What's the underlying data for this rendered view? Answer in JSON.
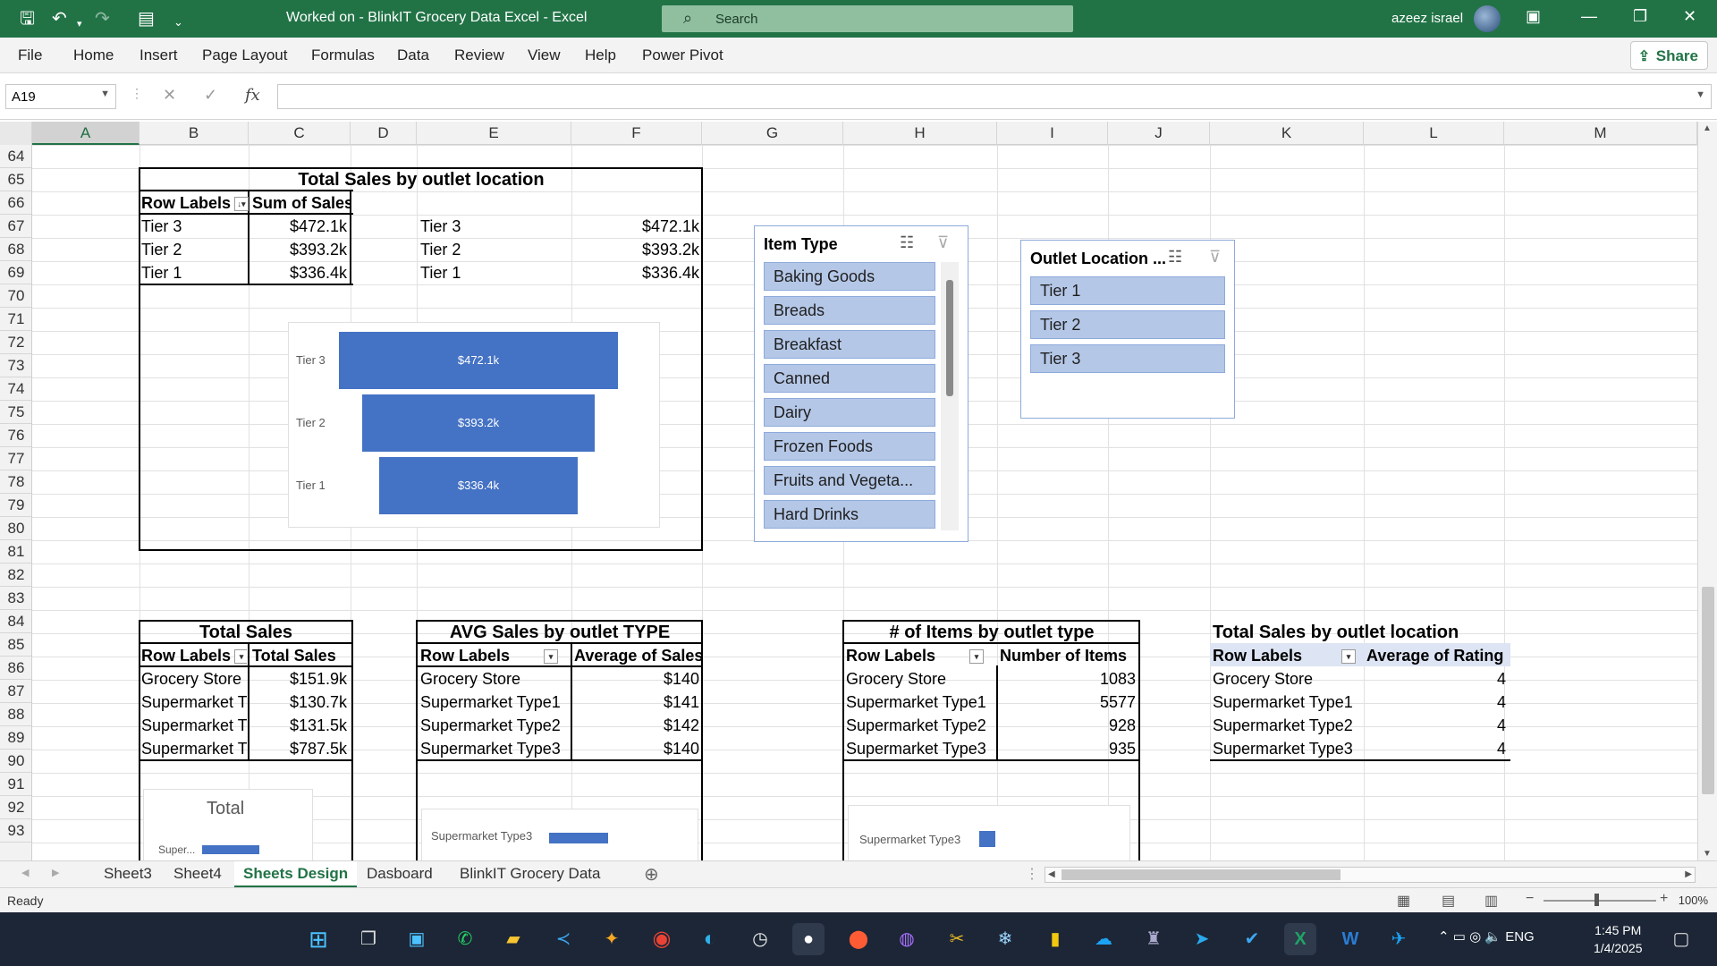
{
  "window": {
    "title": "Worked on - BlinkIT Grocery Data Excel  -  Excel",
    "search_placeholder": "Search",
    "user_name": "azeez israel"
  },
  "ribbon": {
    "tabs": [
      "File",
      "Home",
      "Insert",
      "Page Layout",
      "Formulas",
      "Data",
      "Review",
      "View",
      "Help",
      "Power Pivot"
    ],
    "share_label": "Share"
  },
  "formula_bar": {
    "name_box": "A19",
    "fx": "fx",
    "formula": ""
  },
  "columns": [
    "A",
    "B",
    "C",
    "D",
    "E",
    "F",
    "G",
    "H",
    "I",
    "J",
    "K",
    "L",
    "M"
  ],
  "rows": [
    "64",
    "65",
    "66",
    "67",
    "68",
    "69",
    "70",
    "71",
    "72",
    "73",
    "74",
    "75",
    "76",
    "77",
    "78",
    "79",
    "80",
    "81",
    "82",
    "83",
    "84",
    "85",
    "86",
    "87",
    "88",
    "89",
    "90",
    "91",
    "92",
    "93"
  ],
  "pivot_location": {
    "title": "Total Sales by outlet location",
    "col1": "Row Labels",
    "col2": "Sum of Sales",
    "rows": [
      {
        "label": "Tier 3",
        "value": "$472.1k"
      },
      {
        "label": "Tier 2",
        "value": "$393.2k"
      },
      {
        "label": "Tier 1",
        "value": "$336.4k"
      }
    ],
    "copy_rows": [
      {
        "label": "Tier 3",
        "value": "$472.1k"
      },
      {
        "label": "Tier 2",
        "value": "$393.2k"
      },
      {
        "label": "Tier 1",
        "value": "$336.4k"
      }
    ]
  },
  "chart_data": [
    {
      "type": "bar",
      "subtype": "funnel",
      "categories": [
        "Tier 3",
        "Tier 2",
        "Tier 1"
      ],
      "values": [
        472.1,
        393.2,
        336.4
      ],
      "data_labels": [
        "$472.1k",
        "$393.2k",
        "$336.4k"
      ],
      "color": "#4472c4"
    },
    {
      "type": "bar",
      "title": "Total",
      "categories": [
        "Super..."
      ],
      "note": "partially visible"
    },
    {
      "type": "bar",
      "categories": [
        "Supermarket Type3"
      ],
      "note": "partially visible"
    },
    {
      "type": "bar",
      "categories": [
        "Supermarket Type3"
      ],
      "note": "partially visible"
    }
  ],
  "pivot_total_sales": {
    "title": "Total Sales",
    "col1": "Row Labels",
    "col2": "Total Sales",
    "rows": [
      {
        "label": "Grocery Store",
        "value": "$151.9k"
      },
      {
        "label": "Supermarket T",
        "value": "$130.7k"
      },
      {
        "label": "Supermarket T",
        "value": "$131.5k"
      },
      {
        "label": "Supermarket T",
        "value": "$787.5k"
      }
    ]
  },
  "pivot_avg_sales": {
    "title": "AVG Sales by outlet TYPE",
    "col1": "Row Labels",
    "col2": "Average of Sales",
    "rows": [
      {
        "label": "Grocery Store",
        "value": "$140"
      },
      {
        "label": "Supermarket Type1",
        "value": "$141"
      },
      {
        "label": "Supermarket Type2",
        "value": "$142"
      },
      {
        "label": "Supermarket Type3",
        "value": "$140"
      }
    ]
  },
  "pivot_items": {
    "title": "# of Items by outlet type",
    "col1": "Row Labels",
    "col2": "Number of Items",
    "rows": [
      {
        "label": "Grocery Store",
        "value": "1083"
      },
      {
        "label": "Supermarket Type1",
        "value": "5577"
      },
      {
        "label": "Supermarket Type2",
        "value": "928"
      },
      {
        "label": "Supermarket Type3",
        "value": "935"
      }
    ]
  },
  "pivot_rating": {
    "title": "Total Sales by outlet location",
    "col1": "Row Labels",
    "col2": "Average of Rating",
    "rows": [
      {
        "label": "Grocery Store",
        "value": "4"
      },
      {
        "label": "Supermarket Type1",
        "value": "4"
      },
      {
        "label": "Supermarket Type2",
        "value": "4"
      },
      {
        "label": "Supermarket Type3",
        "value": "4"
      }
    ]
  },
  "charts_small": {
    "total_title": "Total",
    "total_cat": "Super...",
    "avg_cat": "Supermarket Type3",
    "items_cat": "Supermarket Type3"
  },
  "slicer_item_type": {
    "title": "Item Type",
    "items": [
      "Baking Goods",
      "Breads",
      "Breakfast",
      "Canned",
      "Dairy",
      "Frozen Foods",
      "Fruits and Vegeta...",
      "Hard Drinks"
    ]
  },
  "slicer_outlet_location": {
    "title": "Outlet Location ...",
    "items": [
      "Tier 1",
      "Tier 2",
      "Tier 3"
    ]
  },
  "sheet_tabs": [
    "Sheet3",
    "Sheet4",
    "Sheets Design",
    "Dasboard",
    "BlinkIT Grocery Data"
  ],
  "active_sheet": "Sheets Design",
  "status": {
    "ready": "Ready",
    "zoom": "100%"
  },
  "taskbar": {
    "time": "1:45 PM",
    "date": "1/4/2025",
    "lang": "ENG"
  }
}
